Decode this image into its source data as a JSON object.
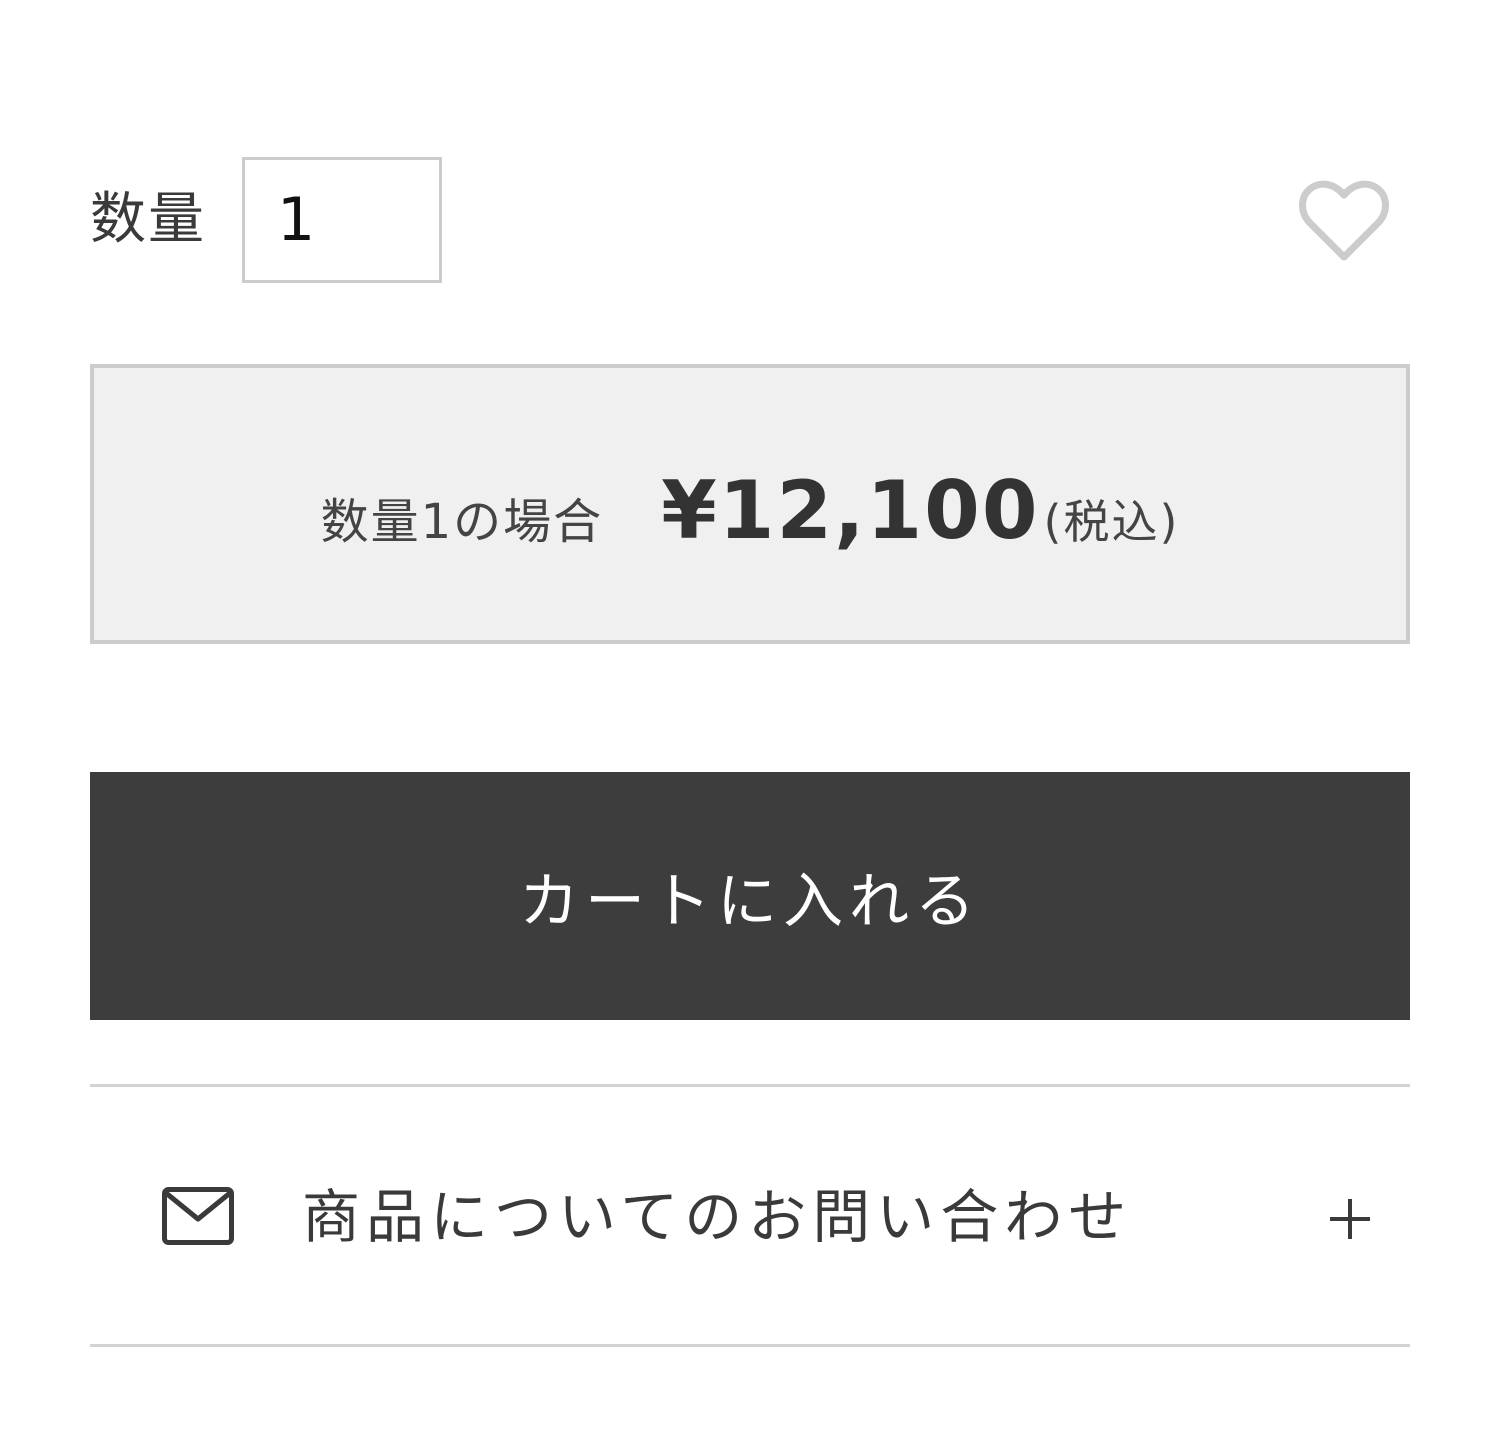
{
  "quantity": {
    "label": "数量",
    "value": "1"
  },
  "favorite": {
    "icon": "heart-outline-icon",
    "color": "#cccccc"
  },
  "price": {
    "caption": "数量1の場合",
    "amount": "¥12,100",
    "tax_note": "(税込)"
  },
  "cart": {
    "button_label": "カートに入れる",
    "background": "#3d3d3d"
  },
  "inquiry": {
    "icon": "mail-icon",
    "label": "商品についてのお問い合わせ",
    "expand_icon": "plus-icon"
  }
}
